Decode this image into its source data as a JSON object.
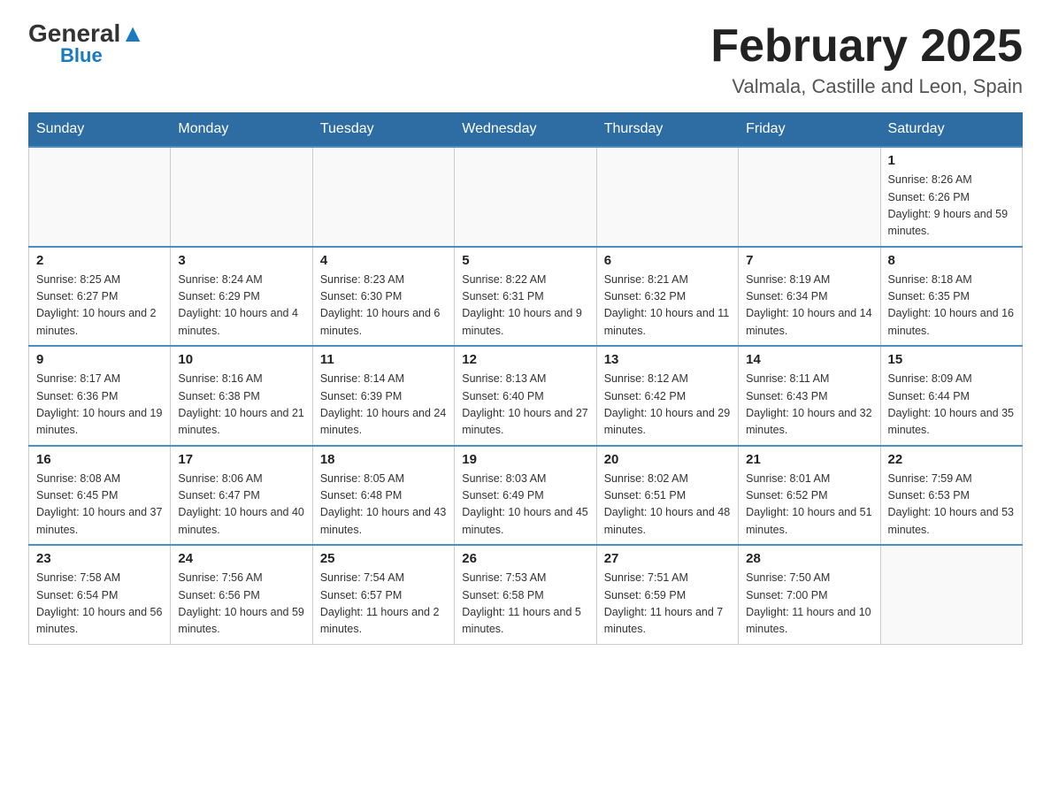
{
  "logo": {
    "text_general": "General",
    "text_blue": "Blue"
  },
  "header": {
    "title": "February 2025",
    "subtitle": "Valmala, Castille and Leon, Spain"
  },
  "days_of_week": [
    "Sunday",
    "Monday",
    "Tuesday",
    "Wednesday",
    "Thursday",
    "Friday",
    "Saturday"
  ],
  "weeks": [
    [
      {
        "day": "",
        "info": ""
      },
      {
        "day": "",
        "info": ""
      },
      {
        "day": "",
        "info": ""
      },
      {
        "day": "",
        "info": ""
      },
      {
        "day": "",
        "info": ""
      },
      {
        "day": "",
        "info": ""
      },
      {
        "day": "1",
        "info": "Sunrise: 8:26 AM\nSunset: 6:26 PM\nDaylight: 9 hours and 59 minutes."
      }
    ],
    [
      {
        "day": "2",
        "info": "Sunrise: 8:25 AM\nSunset: 6:27 PM\nDaylight: 10 hours and 2 minutes."
      },
      {
        "day": "3",
        "info": "Sunrise: 8:24 AM\nSunset: 6:29 PM\nDaylight: 10 hours and 4 minutes."
      },
      {
        "day": "4",
        "info": "Sunrise: 8:23 AM\nSunset: 6:30 PM\nDaylight: 10 hours and 6 minutes."
      },
      {
        "day": "5",
        "info": "Sunrise: 8:22 AM\nSunset: 6:31 PM\nDaylight: 10 hours and 9 minutes."
      },
      {
        "day": "6",
        "info": "Sunrise: 8:21 AM\nSunset: 6:32 PM\nDaylight: 10 hours and 11 minutes."
      },
      {
        "day": "7",
        "info": "Sunrise: 8:19 AM\nSunset: 6:34 PM\nDaylight: 10 hours and 14 minutes."
      },
      {
        "day": "8",
        "info": "Sunrise: 8:18 AM\nSunset: 6:35 PM\nDaylight: 10 hours and 16 minutes."
      }
    ],
    [
      {
        "day": "9",
        "info": "Sunrise: 8:17 AM\nSunset: 6:36 PM\nDaylight: 10 hours and 19 minutes."
      },
      {
        "day": "10",
        "info": "Sunrise: 8:16 AM\nSunset: 6:38 PM\nDaylight: 10 hours and 21 minutes."
      },
      {
        "day": "11",
        "info": "Sunrise: 8:14 AM\nSunset: 6:39 PM\nDaylight: 10 hours and 24 minutes."
      },
      {
        "day": "12",
        "info": "Sunrise: 8:13 AM\nSunset: 6:40 PM\nDaylight: 10 hours and 27 minutes."
      },
      {
        "day": "13",
        "info": "Sunrise: 8:12 AM\nSunset: 6:42 PM\nDaylight: 10 hours and 29 minutes."
      },
      {
        "day": "14",
        "info": "Sunrise: 8:11 AM\nSunset: 6:43 PM\nDaylight: 10 hours and 32 minutes."
      },
      {
        "day": "15",
        "info": "Sunrise: 8:09 AM\nSunset: 6:44 PM\nDaylight: 10 hours and 35 minutes."
      }
    ],
    [
      {
        "day": "16",
        "info": "Sunrise: 8:08 AM\nSunset: 6:45 PM\nDaylight: 10 hours and 37 minutes."
      },
      {
        "day": "17",
        "info": "Sunrise: 8:06 AM\nSunset: 6:47 PM\nDaylight: 10 hours and 40 minutes."
      },
      {
        "day": "18",
        "info": "Sunrise: 8:05 AM\nSunset: 6:48 PM\nDaylight: 10 hours and 43 minutes."
      },
      {
        "day": "19",
        "info": "Sunrise: 8:03 AM\nSunset: 6:49 PM\nDaylight: 10 hours and 45 minutes."
      },
      {
        "day": "20",
        "info": "Sunrise: 8:02 AM\nSunset: 6:51 PM\nDaylight: 10 hours and 48 minutes."
      },
      {
        "day": "21",
        "info": "Sunrise: 8:01 AM\nSunset: 6:52 PM\nDaylight: 10 hours and 51 minutes."
      },
      {
        "day": "22",
        "info": "Sunrise: 7:59 AM\nSunset: 6:53 PM\nDaylight: 10 hours and 53 minutes."
      }
    ],
    [
      {
        "day": "23",
        "info": "Sunrise: 7:58 AM\nSunset: 6:54 PM\nDaylight: 10 hours and 56 minutes."
      },
      {
        "day": "24",
        "info": "Sunrise: 7:56 AM\nSunset: 6:56 PM\nDaylight: 10 hours and 59 minutes."
      },
      {
        "day": "25",
        "info": "Sunrise: 7:54 AM\nSunset: 6:57 PM\nDaylight: 11 hours and 2 minutes."
      },
      {
        "day": "26",
        "info": "Sunrise: 7:53 AM\nSunset: 6:58 PM\nDaylight: 11 hours and 5 minutes."
      },
      {
        "day": "27",
        "info": "Sunrise: 7:51 AM\nSunset: 6:59 PM\nDaylight: 11 hours and 7 minutes."
      },
      {
        "day": "28",
        "info": "Sunrise: 7:50 AM\nSunset: 7:00 PM\nDaylight: 11 hours and 10 minutes."
      },
      {
        "day": "",
        "info": ""
      }
    ]
  ]
}
